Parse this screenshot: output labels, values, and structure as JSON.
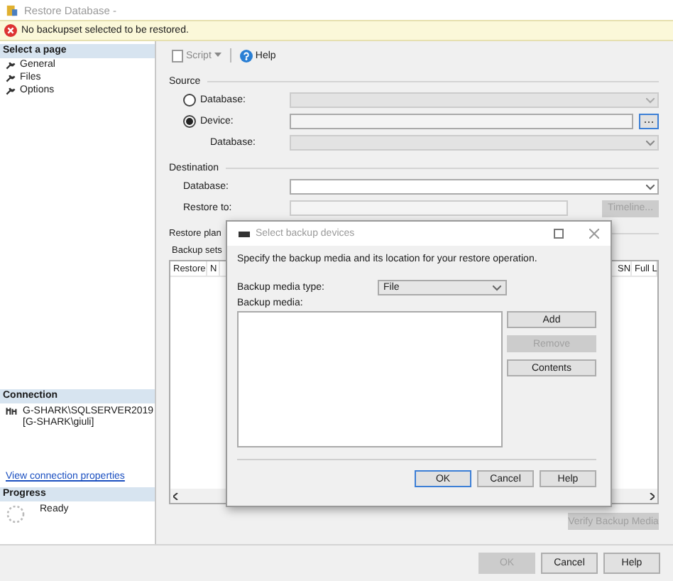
{
  "window": {
    "title": "Restore Database -"
  },
  "error": {
    "message": "No backupset selected to be restored."
  },
  "sidebar": {
    "header": "Select a page",
    "items": [
      "General",
      "Files",
      "Options"
    ]
  },
  "connection": {
    "header": "Connection",
    "server": "G-SHARK\\SQLSERVER2019",
    "user": "[G-SHARK\\giuli]",
    "link": "View connection properties"
  },
  "progress": {
    "header": "Progress",
    "status": "Ready"
  },
  "toolbar": {
    "script": "Script",
    "help": "Help"
  },
  "source": {
    "title": "Source",
    "options": [
      {
        "label": "Database:",
        "selected": false
      },
      {
        "label": "Device:",
        "selected": true
      }
    ],
    "database_label": "Database:"
  },
  "destination": {
    "title": "Destination",
    "database_label": "Database:",
    "restore_to_label": "Restore to:",
    "timeline_button": {
      "label": "Timeline...",
      "disabled": true
    }
  },
  "restore_plan": {
    "title": "Restore plan",
    "backup_sets_label": "Backup sets",
    "columns": [
      "Restore",
      "N",
      "SN",
      "Full L"
    ]
  },
  "verify_button": {
    "label": "Verify Backup Media",
    "disabled": true
  },
  "buttons": [
    {
      "label": "OK",
      "disabled": true
    },
    {
      "label": "Cancel",
      "disabled": false
    },
    {
      "label": "Help",
      "disabled": false
    }
  ],
  "dialog": {
    "title": "Select backup devices",
    "instruction": "Specify the backup media and its location for your restore operation.",
    "media_type_label": "Backup media type:",
    "media_type": "File",
    "media_label": "Backup media:",
    "side_buttons": [
      {
        "label": "Add",
        "disabled": false
      },
      {
        "label": "Remove",
        "disabled": true
      },
      {
        "label": "Contents",
        "disabled": false
      }
    ],
    "buttons": [
      {
        "label": "OK",
        "disabled": false,
        "selected": true
      },
      {
        "label": "Cancel",
        "disabled": false,
        "selected": false
      },
      {
        "label": "Help",
        "disabled": false,
        "selected": false
      }
    ]
  }
}
